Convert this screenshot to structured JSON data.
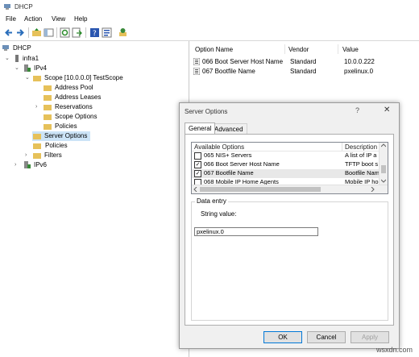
{
  "window": {
    "title": "DHCP"
  },
  "menu": [
    "File",
    "Action",
    "View",
    "Help"
  ],
  "tree": {
    "root": "DHCP",
    "server": "infra1",
    "ipv4": "IPv4",
    "scope": "Scope [10.0.0.0] TestScope",
    "scope_children": [
      "Address Pool",
      "Address Leases",
      "Reservations",
      "Scope Options",
      "Policies"
    ],
    "server_options": "Server Options",
    "policies": "Policies",
    "filters": "Filters",
    "ipv6": "IPv6"
  },
  "list": {
    "columns": [
      "Option Name",
      "Vendor",
      "Value"
    ],
    "rows": [
      {
        "name": "066 Boot Server Host Name",
        "vendor": "Standard",
        "value": "10.0.0.222"
      },
      {
        "name": "067 Bootfile Name",
        "vendor": "Standard",
        "value": "pxelinux.0"
      }
    ]
  },
  "dialog": {
    "title": "Server Options",
    "help": "?",
    "close": "✕",
    "tabs": [
      "General",
      "Advanced"
    ],
    "options_header": [
      "Available Options",
      "Description"
    ],
    "options": [
      {
        "checked": false,
        "name": "065 NIS+ Servers",
        "desc": "A list of IP a"
      },
      {
        "checked": true,
        "name": "066 Boot Server Host Name",
        "desc": "TFTP boot s"
      },
      {
        "checked": true,
        "name": "067 Bootfile Name",
        "desc": "Bootfile Nam"
      },
      {
        "checked": false,
        "name": "068 Mobile IP Home Agents",
        "desc": "Mobile IP ho"
      }
    ],
    "data_entry_legend": "Data entry",
    "string_label": "String value:",
    "string_value": "pxelinux.0",
    "buttons": {
      "ok": "OK",
      "cancel": "Cancel",
      "apply": "Apply"
    }
  },
  "watermark": "wsxdn.com"
}
